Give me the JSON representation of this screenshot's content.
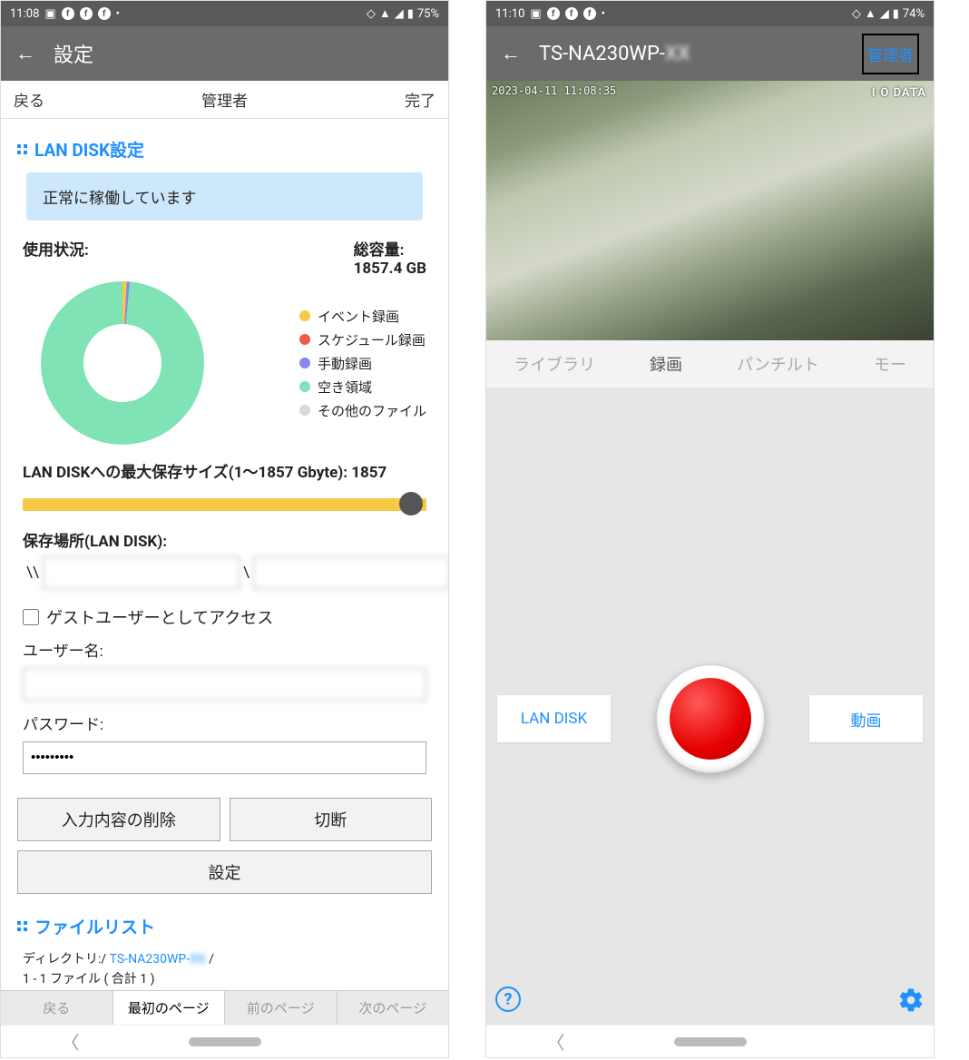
{
  "left": {
    "status_time": "11:08",
    "battery": "75%",
    "app_title": "設定",
    "subbar": {
      "left": "戻る",
      "center": "管理者",
      "right": "完了"
    },
    "section1_title": "LAN DISK設定",
    "status_box": "正常に稼働しています",
    "usage_label": "使用状況:",
    "total_label": "総容量:",
    "total_value": "1857.4 GB",
    "legend": {
      "event": "イベント録画",
      "schedule": "スケジュール録画",
      "manual": "手動録画",
      "free": "空き領域",
      "other": "その他のファイル"
    },
    "slider_label": "LAN DISKへの最大保存サイズ(1〜1857 Gbyte):   1857",
    "save_loc_label": "保存場所(LAN DISK):",
    "path_seg1": "",
    "path_seg2": "",
    "guest_check": "ゲストユーザーとしてアクセス",
    "user_label": "ユーザー名:",
    "user_value": "",
    "pass_label": "パスワード:",
    "pass_value": "•••••••••",
    "btn_clear": "入力内容の削除",
    "btn_disconnect": "切断",
    "btn_settings": "設定",
    "section2_title": "ファイルリスト",
    "dir_label": "ディレクトリ:/ ",
    "dir_link": "TS-NA230WP-",
    "dir_suffix": " /",
    "file_count": "1 - 1 ファイル ( 合計 1 )",
    "pager": {
      "back": "戻る",
      "first": "最初のページ",
      "prev": "前のページ",
      "next": "次のページ"
    }
  },
  "right": {
    "status_time": "11:10",
    "battery": "74%",
    "app_title": "TS-NA230WP-",
    "admin_btn": "管理者",
    "cam_timestamp": "2023-04-11 11:08:35",
    "cam_logo": "I·O DATA",
    "tabs": {
      "library": "ライブラリ",
      "record": "録画",
      "pantilt": "パンチルト",
      "more": "モー"
    },
    "lan_disk": "LAN DISK",
    "video": "動画"
  },
  "chart_data": {
    "type": "pie",
    "title": "使用状況",
    "series": [
      {
        "name": "イベント録画",
        "color": "#f7c944",
        "value_pct": 1
      },
      {
        "name": "スケジュール録画",
        "color": "#f05b4f",
        "value_pct": 0
      },
      {
        "name": "手動録画",
        "color": "#8a86f2",
        "value_pct": 1
      },
      {
        "name": "空き領域",
        "color": "#7fe3b5",
        "value_pct": 98
      },
      {
        "name": "その他のファイル",
        "color": "#d9d9d9",
        "value_pct": 0
      }
    ],
    "total_gb": 1857.4
  }
}
